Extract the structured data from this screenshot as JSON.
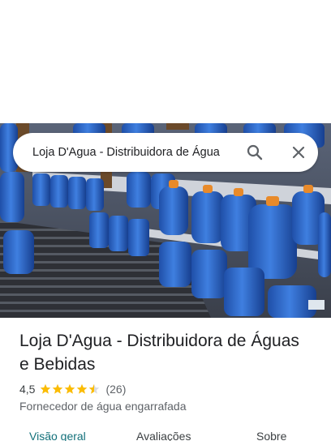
{
  "search": {
    "query": "Loja D'Agua - Distribuidora de Água"
  },
  "place": {
    "name": "Loja D'Agua - Distribuidora de Águas e Bebidas",
    "rating": "4,5",
    "rating_value": 4.5,
    "review_count": "(26)",
    "category": "Fornecedor de água engarrafada"
  },
  "tabs": [
    {
      "label": "Visão geral",
      "active": true
    },
    {
      "label": "Avaliações",
      "active": false
    },
    {
      "label": "Sobre",
      "active": false
    }
  ],
  "colors": {
    "star": "#fbbc04",
    "active_tab": "#12707a",
    "text_secondary": "#5f6368"
  },
  "icons": {
    "search": "search-icon",
    "close": "close-icon"
  }
}
